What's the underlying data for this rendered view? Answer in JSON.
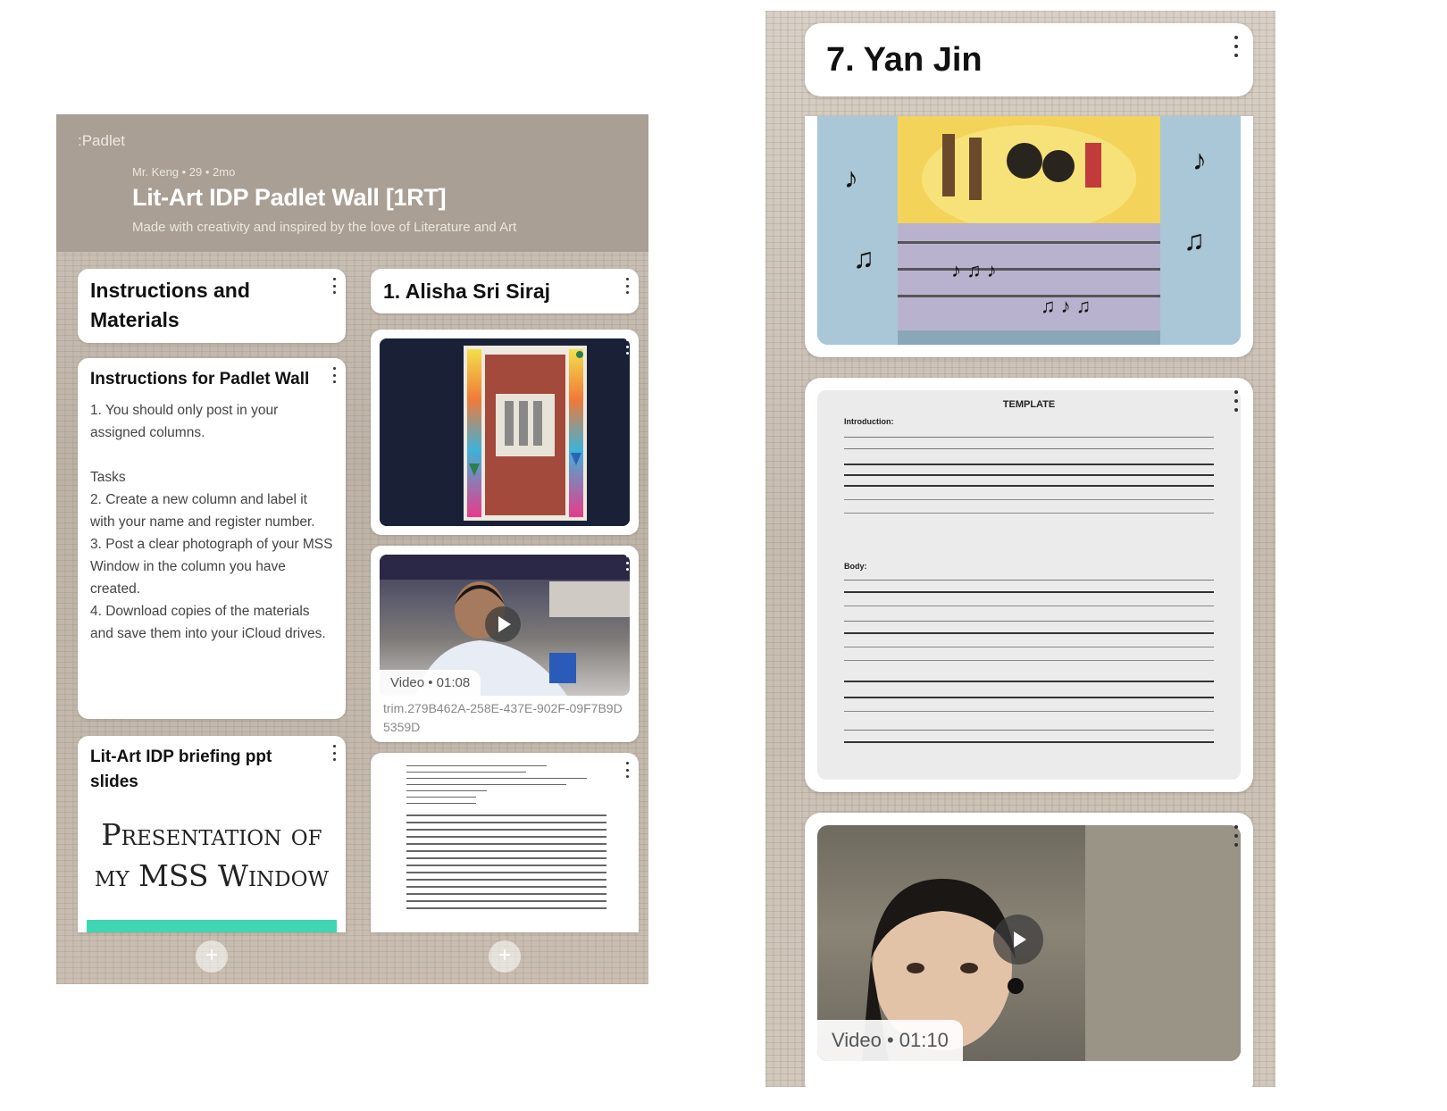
{
  "left": {
    "app_logo": ":Padlet",
    "meta": "Mr. Keng • 29 • 2mo",
    "title": "Lit-Art IDP Padlet Wall [1RT]",
    "subtitle": "Made with creativity and inspired by the love of Literature and Art",
    "column_a": {
      "title": "Instructions and Materials",
      "post1": {
        "title": "Instructions for Padlet Wall",
        "body": "1. You should only post in your assigned columns.\n\nTasks\n2. Create a new column and label it with your name and register number.\n3. Post a clear photograph of your MSS Window in the column you have created.\n4. Download copies of the materials and save them into your iCloud drives."
      },
      "post2": {
        "title": "Lit-Art IDP briefing ppt slides",
        "slide_text": "Presentation of my MSS Window"
      },
      "add_symbol": "+"
    },
    "column_b": {
      "title": "1. Alisha Sri Siraj",
      "video": {
        "badge": "Video • 01:08",
        "filename": "trim.279B462A-258E-437E-902F-09F7B9D5359D"
      },
      "add_symbol": "+"
    }
  },
  "right": {
    "column_title": "7. Yan Jin",
    "template_heading": "TEMPLATE",
    "template_sections": [
      "Introduction:",
      "Body:"
    ],
    "video_badge": "Video • 01:10"
  },
  "colors": {
    "header_bg": "#a99f94",
    "card_bg": "#ffffff",
    "accent_teal": "#3fd6b4"
  }
}
